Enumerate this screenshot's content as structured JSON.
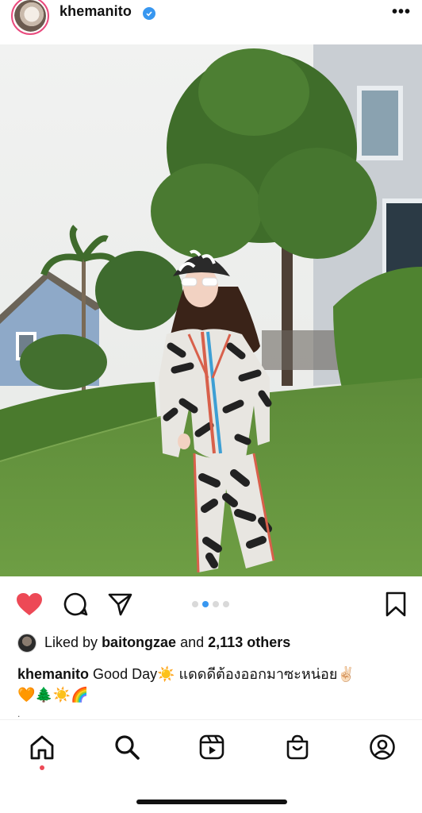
{
  "header": {
    "username": "khemanito",
    "icons": {
      "avatar": "profile-avatar",
      "verified": "verified-badge-icon",
      "more": "more-options-icon"
    },
    "more_label": "•••"
  },
  "post": {
    "image_description_icon": "photo",
    "carousel": {
      "count": 4,
      "active_index": 1
    }
  },
  "actions": {
    "icons": [
      "heart-icon",
      "comment-icon",
      "share-icon",
      "bookmark-icon"
    ],
    "liked": true,
    "like_color": "#ed4956"
  },
  "likes": {
    "prefix": "Liked by",
    "user": "baitongzae",
    "middle": "and",
    "count": "2,113 others"
  },
  "caption": {
    "user": "khemanito",
    "text_line1": "Good Day☀️ แดดดีต้องออกมาซะหน่อย✌🏻",
    "text_line2": "🧡🌲☀️🌈"
  },
  "nav": {
    "items": [
      "home-icon",
      "search-icon",
      "reels-icon",
      "shop-icon",
      "profile-icon"
    ],
    "active": "home-icon",
    "notification_color": "#ed4956"
  }
}
